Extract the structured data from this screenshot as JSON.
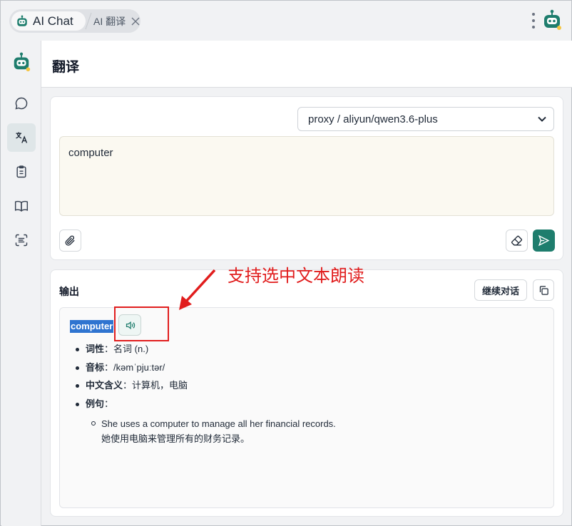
{
  "tabs": [
    {
      "label": "AI Chat",
      "active": true
    },
    {
      "label": "AI 翻译",
      "active": false
    }
  ],
  "header": {
    "title": "翻译"
  },
  "input": {
    "model": "proxy / aliyun/qwen3.6-plus",
    "text": "computer"
  },
  "output": {
    "label": "输出",
    "continue_label": "继续对话",
    "word": "computer",
    "details": [
      {
        "key": "词性",
        "sep": "：",
        "value": "名词 (n.)"
      },
      {
        "key": "音标",
        "sep": "：",
        "value": "/kəmˈpjuːtər/"
      },
      {
        "key": "中文含义",
        "sep": "：",
        "value": "计算机，电脑"
      },
      {
        "key": "例句",
        "sep": "：",
        "value": ""
      }
    ],
    "example_en": "She uses a computer to manage all her financial records.",
    "example_zh": "她使用电脑来管理所有的财务记录。"
  },
  "annotation": {
    "text": "支持选中文本朗读"
  },
  "colors": {
    "accent": "#1e7d6d",
    "highlight": "#2f74d0",
    "annotation": "#e11d1d"
  },
  "icons": [
    "robot-avatar-icon",
    "chat-icon",
    "translate-icon",
    "clipboard-icon",
    "book-icon",
    "scan-text-icon",
    "settings-icon",
    "paperclip-icon",
    "eraser-icon",
    "send-icon",
    "copy-icon",
    "speaker-icon",
    "more-vertical-icon",
    "close-icon",
    "chevron-down-icon"
  ]
}
